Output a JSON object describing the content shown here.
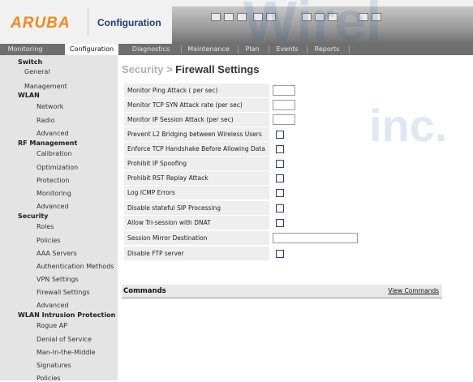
{
  "header": {
    "brand": "ARUBA",
    "app_title": "Configuration",
    "watermark_main": "Wirel",
    "watermark_inc": "inc."
  },
  "tabs": [
    {
      "label": "Monitoring",
      "active": false
    },
    {
      "label": "Configuration",
      "active": true
    },
    {
      "label": "Diagnostics",
      "active": false
    },
    {
      "label": "Maintenance",
      "active": false
    },
    {
      "label": "Plan",
      "active": false
    },
    {
      "label": "Events",
      "active": false
    },
    {
      "label": "Reports",
      "active": false
    }
  ],
  "sidebar": [
    {
      "label": "Switch",
      "type": "section"
    },
    {
      "label": "General",
      "type": "item"
    },
    {
      "label": "Management",
      "type": "item"
    },
    {
      "label": "WLAN",
      "type": "section"
    },
    {
      "label": "Network",
      "type": "item"
    },
    {
      "label": "Radio",
      "type": "item"
    },
    {
      "label": "Advanced",
      "type": "item"
    },
    {
      "label": "RF Management",
      "type": "section"
    },
    {
      "label": "Calibration",
      "type": "item"
    },
    {
      "label": "Optimization",
      "type": "item"
    },
    {
      "label": "Protection",
      "type": "item"
    },
    {
      "label": "Monitoring",
      "type": "item"
    },
    {
      "label": "Advanced",
      "type": "item"
    },
    {
      "label": "Security",
      "type": "section"
    },
    {
      "label": "Roles",
      "type": "item"
    },
    {
      "label": "Policies",
      "type": "item"
    },
    {
      "label": "AAA Servers",
      "type": "item"
    },
    {
      "label": "Authentication Methods",
      "type": "item"
    },
    {
      "label": "VPN Settings",
      "type": "item"
    },
    {
      "label": "Firewall Settings",
      "type": "item"
    },
    {
      "label": "Advanced",
      "type": "item"
    },
    {
      "label": "WLAN Intrusion Protection",
      "type": "section"
    },
    {
      "label": "Rogue AP",
      "type": "item"
    },
    {
      "label": "Denial of Service",
      "type": "item"
    },
    {
      "label": "Man-In-the-Middle",
      "type": "item"
    },
    {
      "label": "Signatures",
      "type": "item"
    },
    {
      "label": "Policies",
      "type": "item"
    }
  ],
  "page": {
    "crumb": "Security",
    "separator": ">",
    "title": "Firewall Settings"
  },
  "settings": [
    {
      "label": "Monitor Ping Attack ( per sec)",
      "control": "text",
      "value": ""
    },
    {
      "label": "Monitor TCP SYN Attack rate (per sec)",
      "control": "text",
      "value": ""
    },
    {
      "label": "Monitor IP Session Attack (per sec)",
      "control": "text",
      "value": ""
    },
    {
      "label": "Prevent L2 Bridging between Wireless Users",
      "control": "checkbox",
      "checked": false
    },
    {
      "label": "Enforce TCP Handshake Before Allowing Data",
      "control": "checkbox",
      "checked": false
    },
    {
      "label": "Prohibit IP Spoofing",
      "control": "checkbox",
      "checked": false
    },
    {
      "label": "Prohibit RST Replay Attack",
      "control": "checkbox",
      "checked": false
    },
    {
      "label": "Log ICMP Errors",
      "control": "checkbox",
      "checked": false
    },
    {
      "label": "Disable stateful SIP Processing",
      "control": "checkbox",
      "checked": false
    },
    {
      "label": "Allow Tri-session with DNAT",
      "control": "checkbox",
      "checked": false
    },
    {
      "label": "Session Mirror Destination",
      "control": "wide-text",
      "value": ""
    },
    {
      "label": "Disable FTP server",
      "control": "checkbox",
      "checked": false
    }
  ],
  "commands": {
    "title": "Commands",
    "link": "View Commands"
  }
}
